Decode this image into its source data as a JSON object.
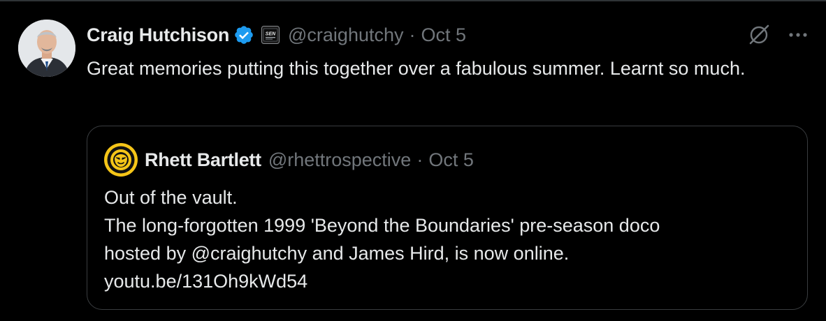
{
  "tweet": {
    "display_name": "Craig Hutchison",
    "handle": "@craighutchy",
    "separator": "·",
    "date": "Oct 5",
    "verified_color": "#1d9bf0",
    "affiliate_badge_text": "SEN",
    "text": "Great memories putting this together over a fabulous summer. Learnt so much.",
    "icons": [
      "grok-icon",
      "more-icon",
      "verified-icon"
    ]
  },
  "quote": {
    "display_name": "Rhett Bartlett",
    "handle": "@rhettrospective",
    "separator": "·",
    "date": "Oct 5",
    "lines": [
      "Out of the vault.",
      "The long-forgotten 1999 'Beyond the Boundaries' pre-season doco",
      "hosted by @craighutchy and James Hird, is now online.",
      "youtu.be/131Oh9kWd54"
    ]
  },
  "colors": {
    "background": "#000000",
    "text": "#e7e9ea",
    "secondary": "#71767b",
    "border": "#3a3d40",
    "accent": "#1d9bf0",
    "quote_avatar_ring": "#f5c518"
  }
}
